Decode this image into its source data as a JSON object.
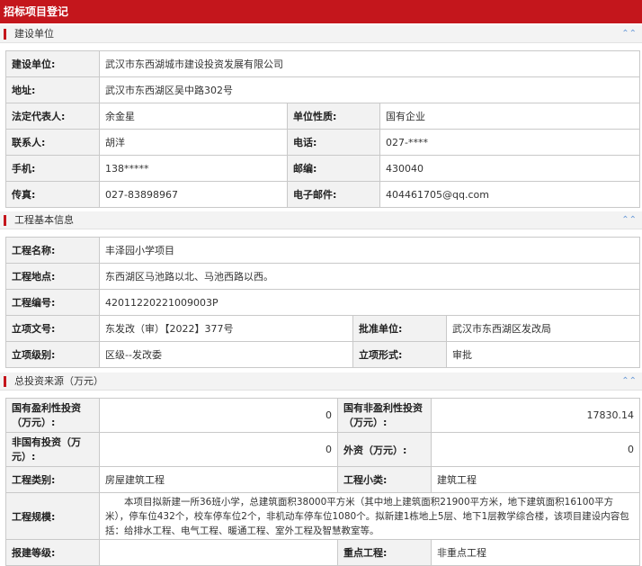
{
  "window": {
    "title": "招标项目登记"
  },
  "sections": {
    "builder": {
      "title": "建设单位"
    },
    "project": {
      "title": "工程基本信息"
    },
    "investment": {
      "title": "总投资来源（万元）"
    }
  },
  "icons": {
    "collapse": "double-chevron-up-icon"
  },
  "colors": {
    "accent": "#c4161c",
    "label_bg": "#f2f2f2",
    "border": "#c9c9c9",
    "chevron": "#6a9bd8"
  },
  "builder": {
    "unit_label": "建设单位:",
    "unit_value": "武汉市东西湖城市建设投资发展有限公司",
    "address_label": "地址:",
    "address_value": "武汉市东西湖区吴中路302号",
    "legal_rep_label": "法定代表人:",
    "legal_rep_value": "余金星",
    "unit_type_label": "单位性质:",
    "unit_type_value": "国有企业",
    "contact_label": "联系人:",
    "contact_value": "胡洋",
    "phone_label": "电话:",
    "phone_value": "027-****",
    "mobile_label": "手机:",
    "mobile_value": "138*****",
    "zip_label": "邮编:",
    "zip_value": "430040",
    "fax_label": "传真:",
    "fax_value": "027-83898967",
    "email_label": "电子邮件:",
    "email_value": "404461705@qq.com"
  },
  "project": {
    "name_label": "工程名称:",
    "name_value": "丰泽园小学项目",
    "location_label": "工程地点:",
    "location_value": "东西湖区马池路以北、马池西路以西。",
    "code_label": "工程编号:",
    "code_value": "42011220221009003P",
    "approval_doc_label": "立项文号:",
    "approval_doc_value": "东发改（审）【2022】377号",
    "approval_unit_label": "批准单位:",
    "approval_unit_value": "武汉市东西湖区发改局",
    "level_label": "立项级别:",
    "level_value": "区级--发改委",
    "form_label": "立项形式:",
    "form_value": "审批"
  },
  "investment": {
    "state_profit_label": "国有盈利性投资（万元）:",
    "state_profit_value": "0",
    "state_nonprofit_label": "国有非盈利性投资（万元）:",
    "state_nonprofit_value": "17830.14",
    "non_state_label": "非国有投资（万元）:",
    "non_state_value": "0",
    "foreign_label": "外资（万元）:",
    "foreign_value": "0",
    "category_label": "工程类别:",
    "category_value": "房屋建筑工程",
    "subcategory_label": "工程小类:",
    "subcategory_value": "建筑工程",
    "scale_label": "工程规模:",
    "scale_value": "本项目拟新建一所36班小学，总建筑面积38000平方米（其中地上建筑面积21900平方米，地下建筑面积16100平方米），停车位432个，校车停车位2个，非机动车停车位1080个。拟新建1栋地上5层、地下1层教学综合楼，该项目建设内容包括：给排水工程、电气工程、暖通工程、室外工程及智慧教室等。",
    "grade_label": "报建等级:",
    "grade_value": "",
    "key_label": "重点工程:",
    "key_value": "非重点工程"
  }
}
